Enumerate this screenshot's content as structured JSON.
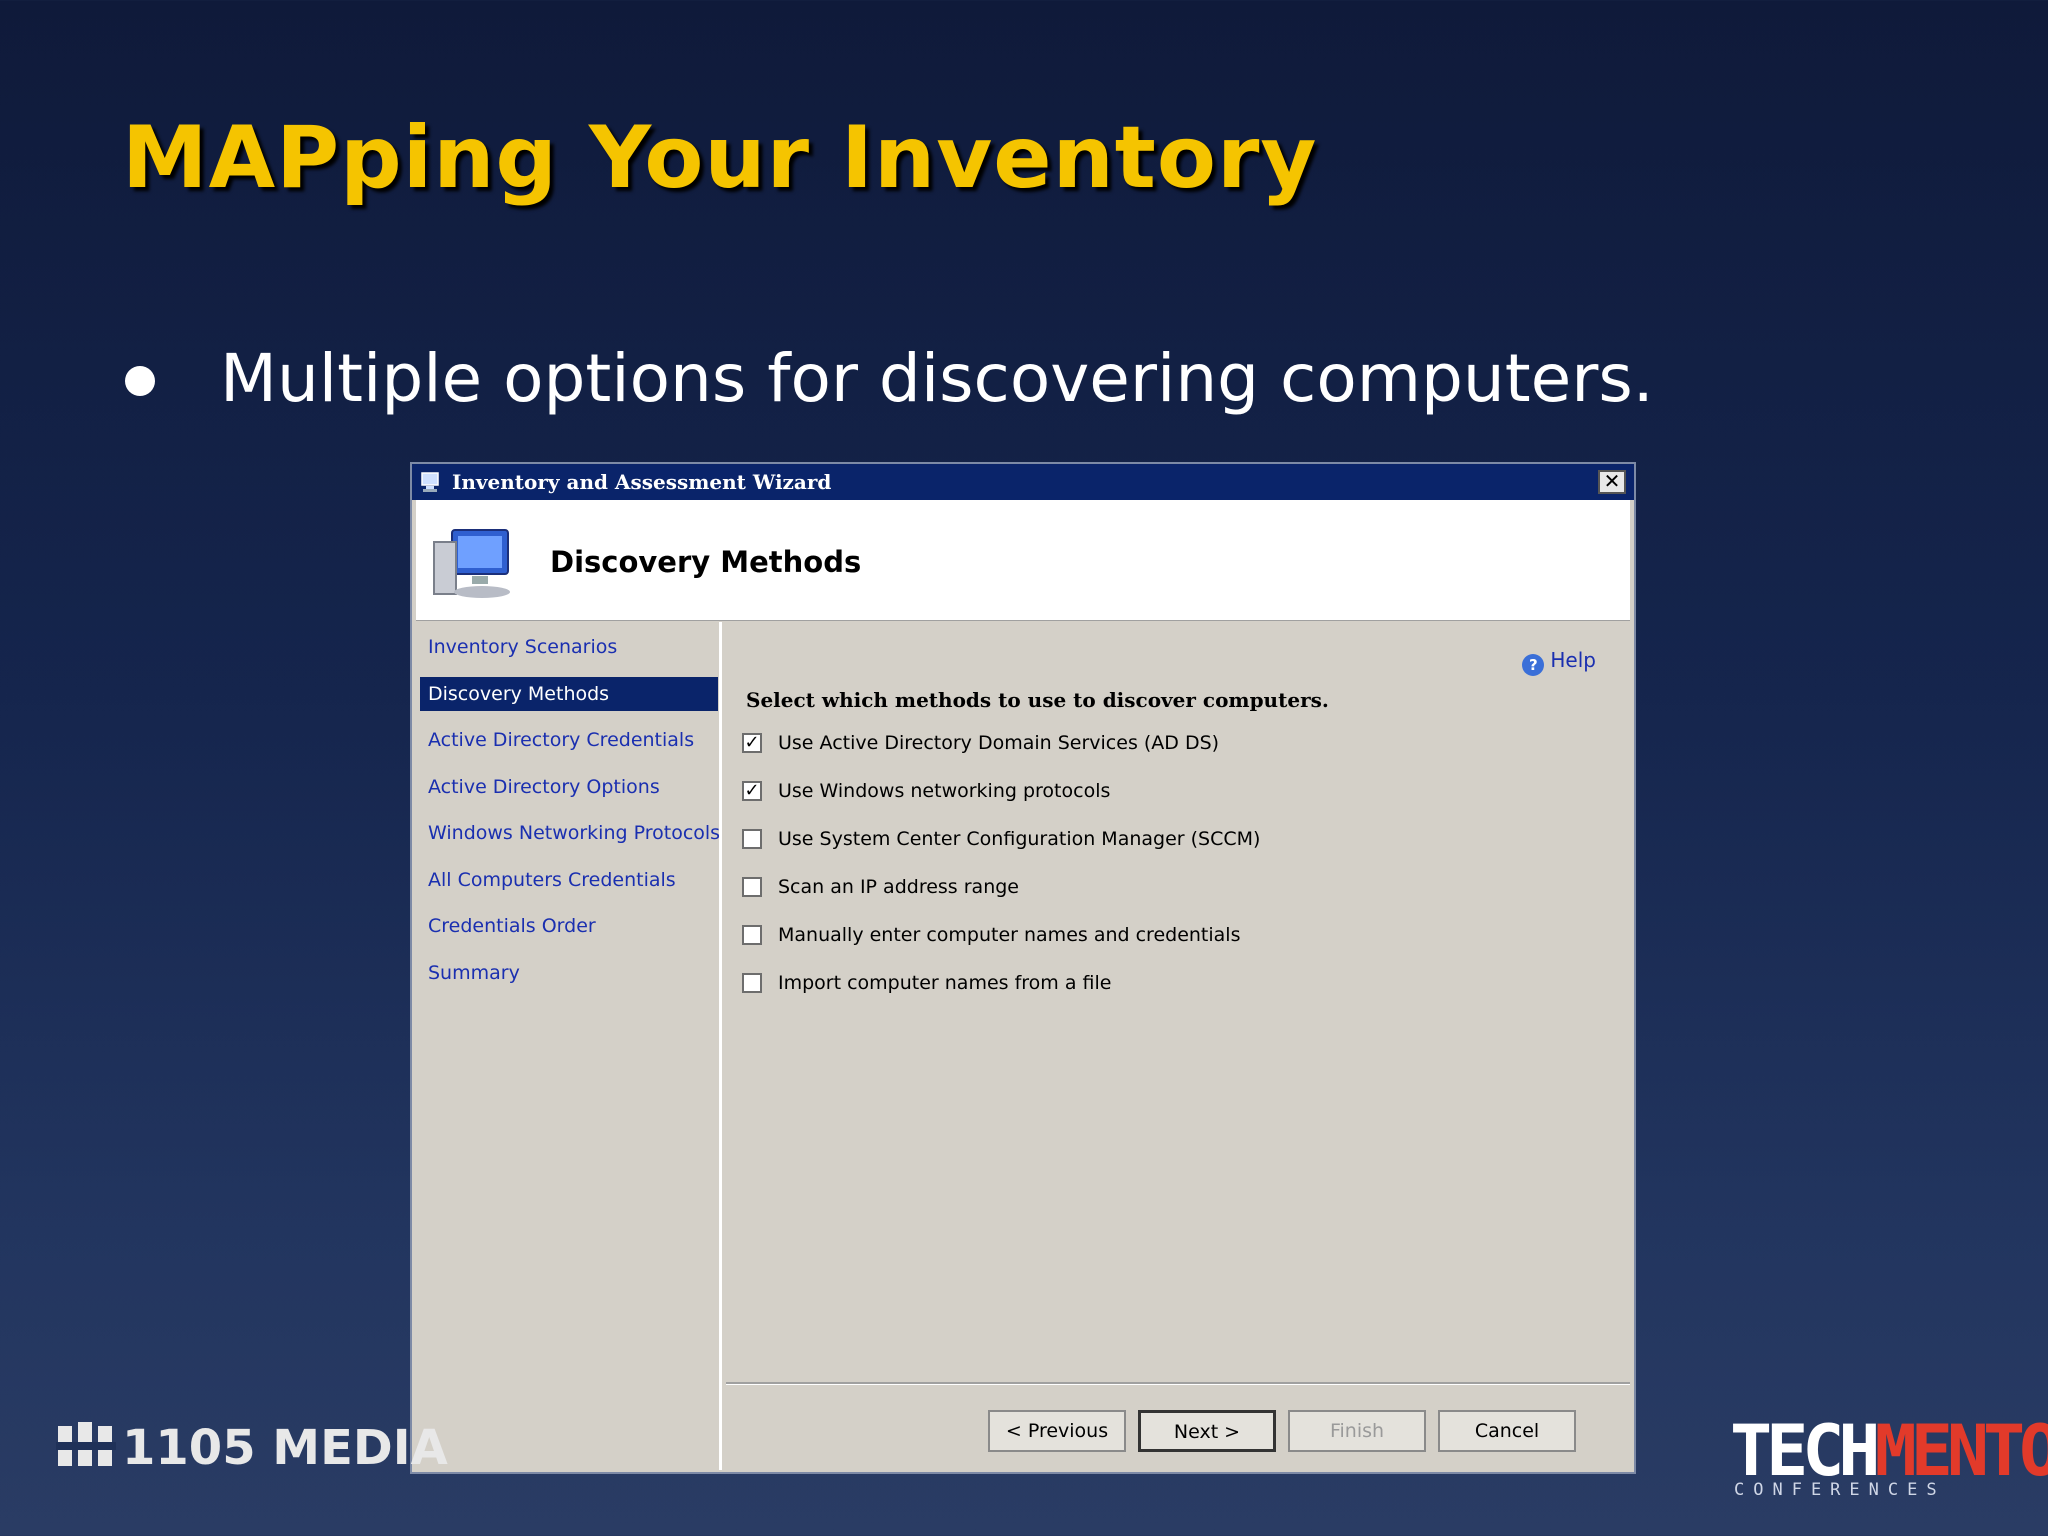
{
  "slide": {
    "title": "MAPping Your Inventory",
    "bullet": "Multiple options for discovering computers."
  },
  "wizard": {
    "window_title": "Inventory and Assessment Wizard",
    "close_label": "✕",
    "page_heading": "Discovery Methods",
    "nav": [
      {
        "label": "Inventory Scenarios",
        "active": false
      },
      {
        "label": "Discovery Methods",
        "active": true
      },
      {
        "label": "Active Directory Credentials",
        "active": false
      },
      {
        "label": "Active Directory Options",
        "active": false
      },
      {
        "label": "Windows Networking Protocols",
        "active": false
      },
      {
        "label": "All Computers Credentials",
        "active": false
      },
      {
        "label": "Credentials Order",
        "active": false
      },
      {
        "label": "Summary",
        "active": false
      }
    ],
    "help_label": "Help",
    "instruction": "Select which methods to use to discover computers.",
    "options": [
      {
        "label": "Use Active Directory Domain Services (AD DS)",
        "checked": true
      },
      {
        "label": "Use Windows networking protocols",
        "checked": true
      },
      {
        "label": "Use System Center Configuration Manager (SCCM)",
        "checked": false
      },
      {
        "label": "Scan an IP address range",
        "checked": false
      },
      {
        "label": "Manually enter computer names and credentials",
        "checked": false
      },
      {
        "label": "Import computer names from a file",
        "checked": false
      }
    ],
    "buttons": {
      "previous": "< Previous",
      "next": "Next >",
      "finish": "Finish",
      "cancel": "Cancel"
    }
  },
  "logos": {
    "left": "1105 MEDIA",
    "right_part1": "TECH",
    "right_part2": "MENTOR",
    "right_sub": "CONFERENCES"
  },
  "colors": {
    "title_yellow": "#f5c400",
    "wizard_titlebar": "#0a246a",
    "nav_link": "#1a2fb0"
  }
}
